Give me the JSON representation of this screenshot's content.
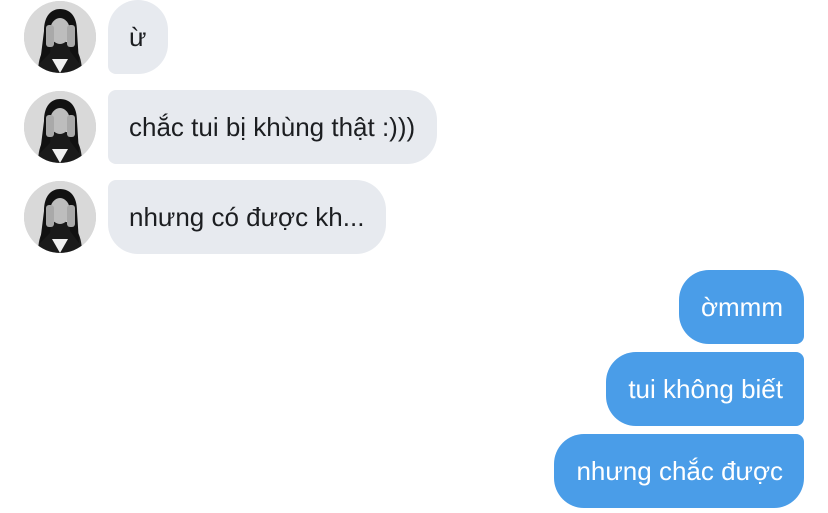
{
  "conversation": {
    "incoming": [
      {
        "text": "ừ",
        "avatar": "avatar-icon"
      },
      {
        "text": "chắc tui bị khùng thật :)))",
        "avatar": "avatar-icon"
      },
      {
        "text": "nhưng có được kh...",
        "avatar": "avatar-icon"
      }
    ],
    "outgoing": [
      {
        "text": "ờmmm"
      },
      {
        "text": "tui không biết"
      },
      {
        "text": "nhưng chắc được"
      }
    ]
  },
  "colors": {
    "incoming_bubble": "#e7eaef",
    "incoming_text": "#1c1e21",
    "outgoing_bubble": "#4a9de8",
    "outgoing_text": "#ffffff"
  }
}
